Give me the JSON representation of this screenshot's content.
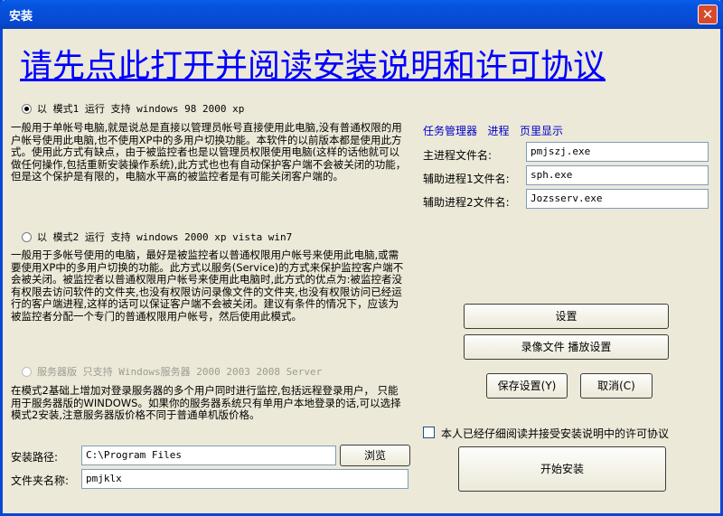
{
  "window": {
    "title": "安装",
    "close_glyph": "✕"
  },
  "header_link": "请先点此打开并阅读安装说明和许可协议",
  "mode1": {
    "label": "以 模式1 运行 支持 windows 98 2000 xp",
    "selected": true,
    "description": "一般用于单帐号电脑,就是说总是直接以管理员帐号直接使用此电脑,没有普通权限的用户帐号使用此电脑,也不使用XP中的多用户切换功能。本软件的以前版本都是使用此方式。使用此方式有缺点，由于被监控者也是以管理员权限使用电脑(这样的话他就可以做任何操作,包括重新安装操作系统),此方式也也有自动保护客户端不会被关闭的功能，但是这个保护是有限的，电脑水平高的被监控者是有可能关闭客户端的。"
  },
  "mode2": {
    "label": "以 模式2 运行 支持 windows 2000 xp vista win7",
    "selected": false,
    "description": "一般用于多帐号使用的电脑，最好是被监控者以普通权限用户帐号来使用此电脑,或需要使用XP中的多用户切换的功能。此方式以服务(Service)的方式来保护监控客户端不会被关闭。被监控者以普通权限用户帐号来使用此电脑时,此方式的优点为:被监控者没有权限去访问软件的文件夹,也没有权限访问录像文件的文件夹,也没有权限访问已经运行的客户端进程,这样的话可以保证客户端不会被关闭。建议有条件的情况下，应该为被监控者分配一个专门的普通权限用户帐号，然后使用此模式。"
  },
  "server_mode": {
    "label": "服务器版 只支持 Windows服务器 2000 2003 2008 Server",
    "enabled": false,
    "description": "在模式2基础上增加对登录服务器的多个用户同时进行监控,包括远程登录用户， 只能用于服务器版的WINDOWS。如果你的服务器系统只有单用户本地登录的话,可以选择模式2安装,注意服务器版价格不同于普通单机版价格。"
  },
  "task_manager": {
    "heading_1": "任务管理器",
    "heading_2": "进程",
    "heading_3": "页里显示",
    "rows": [
      {
        "label": "主进程文件名:",
        "value": "pmjszj.exe"
      },
      {
        "label": "辅助进程1文件名:",
        "value": "sph.exe"
      },
      {
        "label": "辅助进程2文件名:",
        "value": "Jozsserv.exe"
      }
    ]
  },
  "buttons": {
    "settings": "设置",
    "recording_settings": "录像文件 播放设置",
    "save_settings": "保存设置(Y)",
    "cancel": "取消(C)",
    "start_install": "开始安装",
    "browse": "浏览"
  },
  "agreement": {
    "label": "本人已经仔细阅读并接受安装说明中的许可协议",
    "checked": false
  },
  "install_path": {
    "label": "安装路径:",
    "value": "C:\\Program Files"
  },
  "folder_name": {
    "label": "文件夹名称:",
    "value": "pmjklx"
  }
}
